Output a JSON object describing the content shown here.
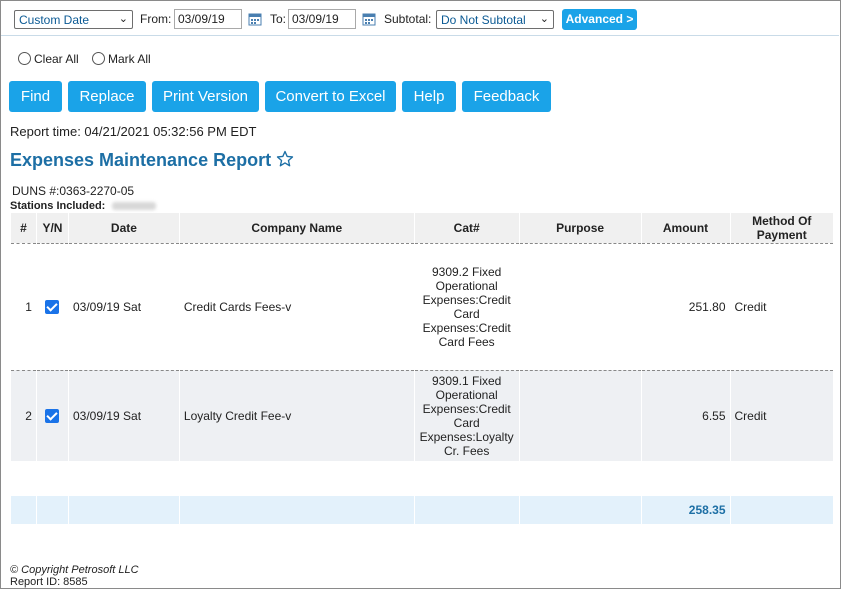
{
  "filters": {
    "range_select": "Custom Date",
    "from_label": "From:",
    "from_value": "03/09/19",
    "to_label": "To:",
    "to_value": "03/09/19",
    "subtotal_label": "Subtotal:",
    "subtotal_select": "Do Not Subtotal",
    "advanced_label": "Advanced >"
  },
  "radios": {
    "clear_all": "Clear All",
    "mark_all": "Mark All"
  },
  "buttons": {
    "find": "Find",
    "replace": "Replace",
    "print": "Print Version",
    "excel": "Convert to Excel",
    "help": "Help",
    "feedback": "Feedback"
  },
  "report": {
    "time": "Report time: 04/21/2021 05:32:56 PM EDT",
    "title": "Expenses Maintenance Report",
    "duns": "DUNS #:0363-2270-05",
    "stations_label": "Stations Included:"
  },
  "table": {
    "headers": [
      "#",
      "Y/N",
      "Date",
      "Company Name",
      "Cat#",
      "Purpose",
      "Amount",
      "Method Of Payment"
    ],
    "rows": [
      {
        "num": "1",
        "date": "03/09/19 Sat",
        "company": "Credit Cards Fees-v",
        "cat": "9309.2 Fixed Operational Expenses:Credit Card Expenses:Credit Card Fees",
        "purpose": "",
        "amount": "251.80",
        "method": "Credit"
      },
      {
        "num": "2",
        "date": "03/09/19 Sat",
        "company": "Loyalty Credit Fee-v",
        "cat": "9309.1 Fixed Operational Expenses:Credit Card Expenses:Loyalty Cr. Fees",
        "purpose": "",
        "amount": "6.55",
        "method": "Credit"
      }
    ],
    "total": "258.35"
  },
  "footer": {
    "copyright": "© Copyright Petrosoft LLC",
    "report_id": "Report ID: 8585"
  },
  "colors": {
    "accent": "#1aa3e8",
    "title": "#1d6fa5",
    "total_bg": "#e3f1fb"
  }
}
